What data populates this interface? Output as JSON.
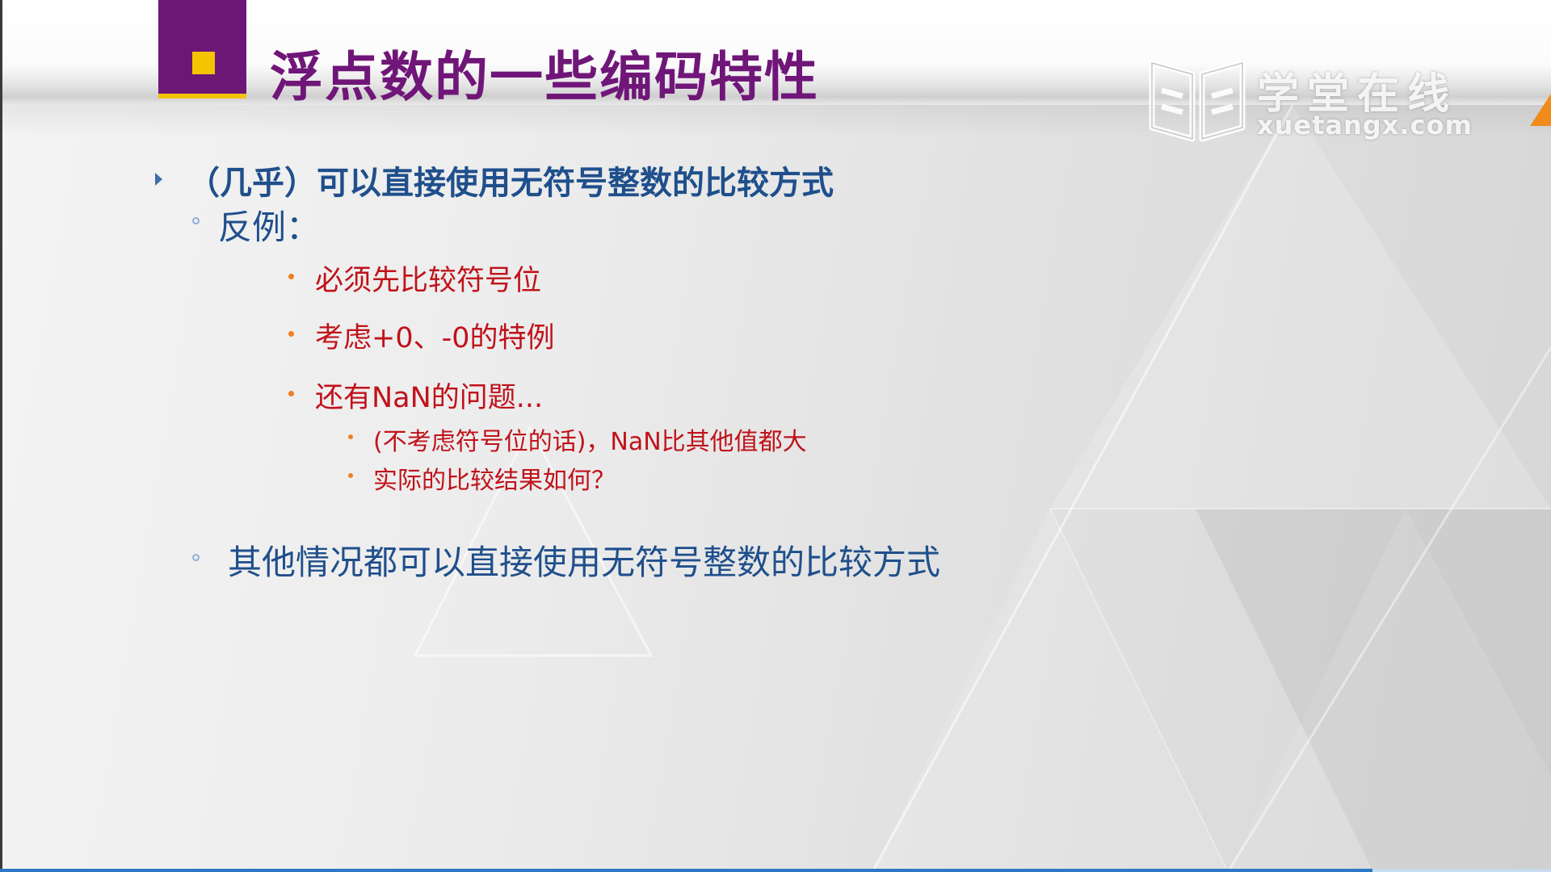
{
  "slide": {
    "title": "浮点数的一些编码特性",
    "watermark": {
      "name_cn": "学堂在线",
      "domain": "xuetangx.com"
    },
    "content": {
      "point1": "（几乎）可以直接使用无符号整数的比较方式",
      "sub1": "反例：",
      "counter_examples": [
        "必须先比较符号位",
        "考虑+0、-0的特例",
        "还有NaN的问题..."
      ],
      "nan_notes": [
        "(不考虑符号位的话)，NaN比其他值都大",
        "实际的比较结果如何？"
      ],
      "sub2": "其他情况都可以直接使用无符号整数的比较方式"
    }
  },
  "colors": {
    "title": "#6f1678",
    "title_square": "#6c1776",
    "title_accent": "#f6c300",
    "level1_text": "#1f4f8c",
    "level3_text": "#c0121a",
    "bullet_orange": "#f07f22",
    "progress": "#2b78c8"
  },
  "player": {
    "progress": 0.885
  }
}
